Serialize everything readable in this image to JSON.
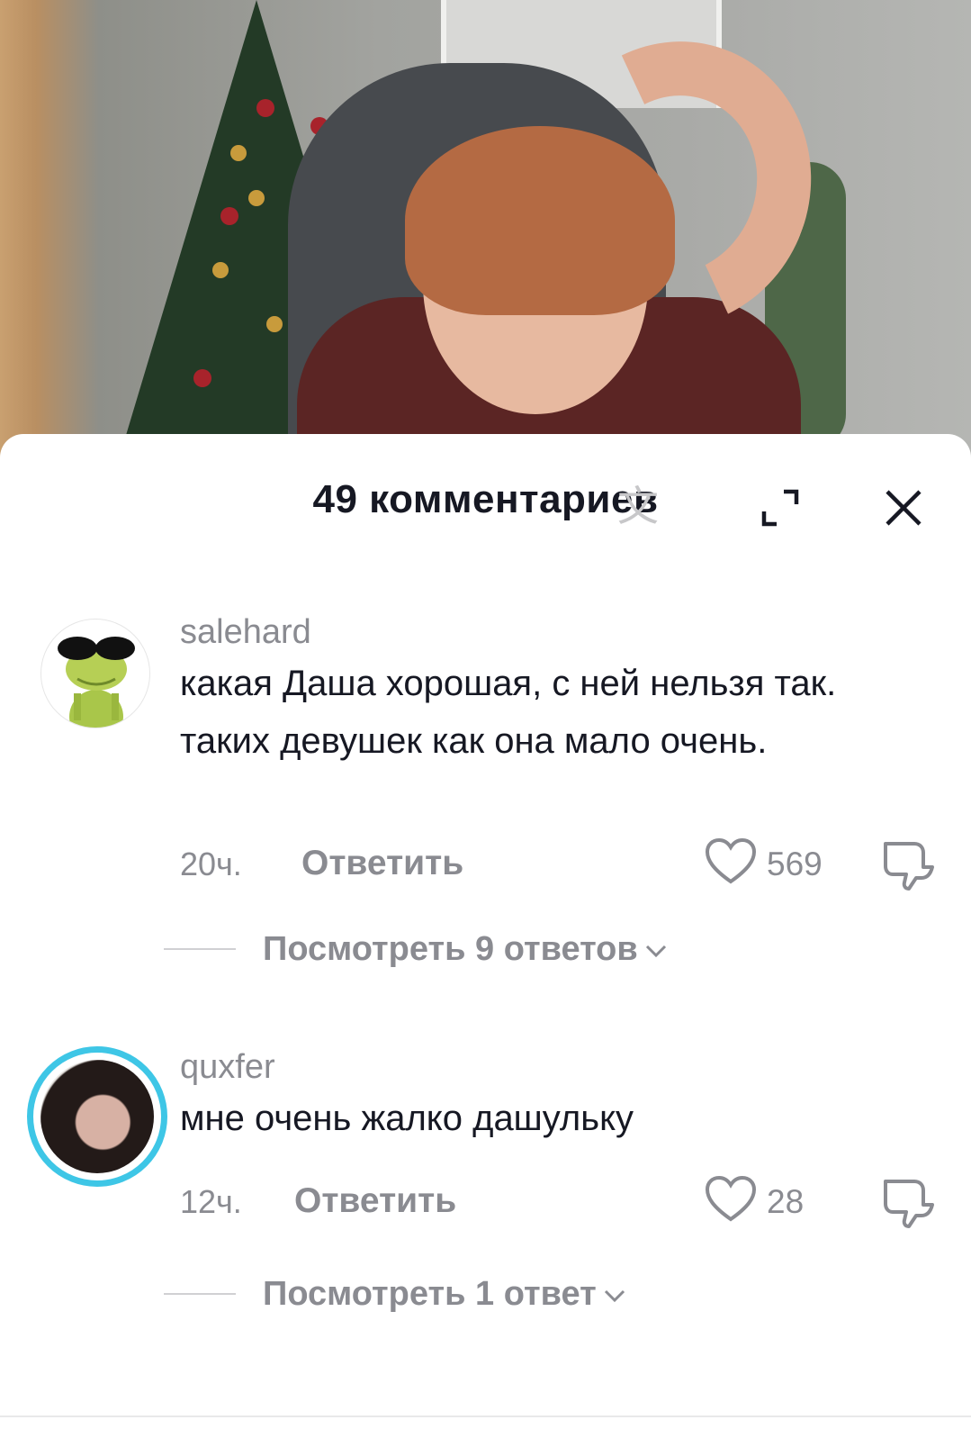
{
  "header": {
    "title": "49 комментариев"
  },
  "comments": [
    {
      "username": "salehard",
      "text": "какая Даша хорошая, с ней нельзя так. таких девушек как она мало очень.",
      "time": "20ч.",
      "reply_label": "Ответить",
      "likes": "569",
      "view_replies": "Посмотреть 9 ответов"
    },
    {
      "username": "quxfer",
      "text": "мне очень жалко дашульку",
      "time": "12ч.",
      "reply_label": "Ответить",
      "likes": "28",
      "view_replies": "Посмотреть 1 ответ"
    }
  ],
  "colors": {
    "text_primary": "#161823",
    "text_secondary": "#8a8b91",
    "story_ring": "#3ec6e6"
  },
  "icons": [
    "translate-icon",
    "expand-icon",
    "close-icon",
    "heart-icon",
    "dislike-icon",
    "chevron-down-icon"
  ]
}
